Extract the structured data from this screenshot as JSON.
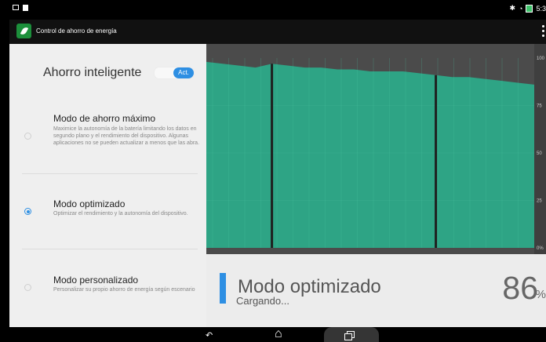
{
  "status_bar": {
    "time": "5:3"
  },
  "app": {
    "title": "Control de ahorro de energía"
  },
  "smart_saving": {
    "title": "Ahorro inteligente",
    "toggle_label": "Act.",
    "enabled": true
  },
  "modes": [
    {
      "title": "Modo de ahorro máximo",
      "description": "Maximice la autonomía de la batería limitando los datos en segundo plano y el rendimiento del dispositivo. Algunas aplicaciones no se pueden actualizar a menos que las abra.",
      "selected": false
    },
    {
      "title": "Modo optimizado",
      "description": "Optimizar el rendimiento y la autonomía del dispositivo.",
      "selected": true
    },
    {
      "title": "Modo personalizado",
      "description": "Personalizar su propio ahorro de energía según escenario",
      "selected": false
    }
  ],
  "chart_data": {
    "type": "area",
    "x": [
      0,
      1,
      2,
      3,
      4,
      5,
      6,
      7,
      8,
      9,
      10,
      11,
      12,
      13,
      14,
      15,
      16,
      17,
      18,
      19,
      20
    ],
    "series": [
      {
        "values": [
          98,
          97,
          96,
          95,
          97,
          96,
          95,
          95,
          94,
          94,
          93,
          93,
          93,
          92,
          91,
          90,
          90,
          89,
          88,
          87,
          86
        ]
      }
    ],
    "ylim": [
      0,
      100
    ],
    "y_ticks": [
      "100",
      "75",
      "50",
      "25",
      "0%"
    ],
    "segment_breaks": [
      4,
      14
    ],
    "grid": true,
    "colors": {
      "fill": "#2ea485",
      "fill_dark": "#218667",
      "background": "#4b4b4b",
      "grid": "#51c7a4"
    }
  },
  "summary": {
    "mode": "Modo optimizado",
    "status": "Cargando...",
    "percent": "86",
    "percent_sign": "%"
  }
}
